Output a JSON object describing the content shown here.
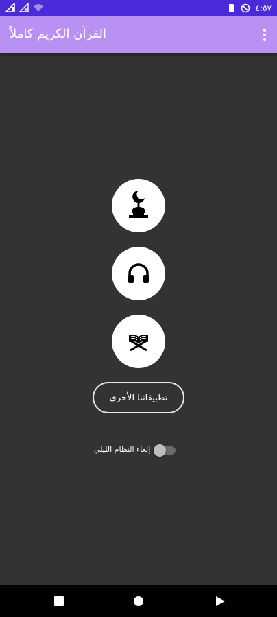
{
  "status_bar": {
    "time": "٤:٥٧",
    "background": "#4a2ad9"
  },
  "app_bar": {
    "title": "القرآن الكريم كاملاً",
    "background": "#b891f3",
    "overflow_icon": "more-vert-icon"
  },
  "main": {
    "background": "#333333",
    "buttons": [
      {
        "icon": "mosque-crescent-icon"
      },
      {
        "icon": "headphones-icon"
      },
      {
        "icon": "quran-book-icon"
      }
    ],
    "other_apps_label": "تطبيقاتنا الأخرى",
    "night_mode": {
      "label": "إلغاء النظام الليلي",
      "checked": false
    }
  },
  "nav_bar": {
    "items": [
      "recents-icon",
      "home-icon",
      "back-icon"
    ]
  }
}
